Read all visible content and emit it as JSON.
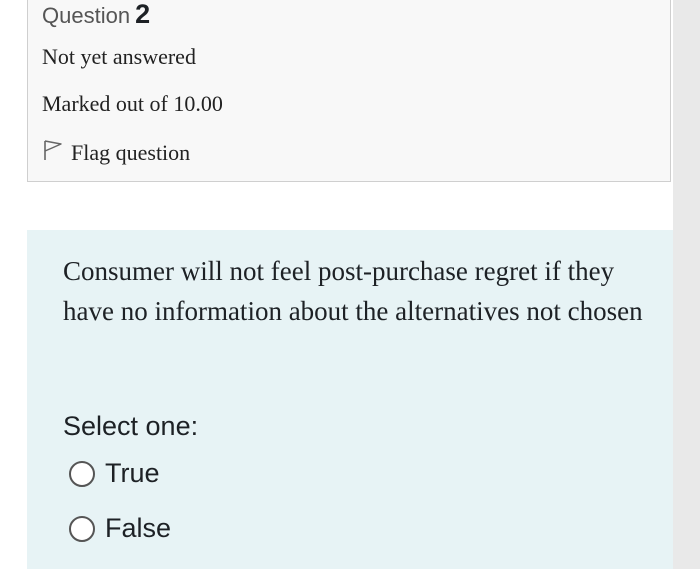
{
  "question": {
    "label": "Question",
    "number": "2",
    "state": "Not yet answered",
    "grade": "Marked out of 10.00",
    "flag_label": "Flag question",
    "text": "Consumer will not feel post-purchase regret if they have no information about the alternatives not chosen",
    "prompt": "Select one:",
    "options": [
      {
        "label": "True",
        "selected": false
      },
      {
        "label": "False",
        "selected": false
      }
    ]
  },
  "colors": {
    "info_background": "#f8f8f8",
    "formulation_background": "#e7f3f5"
  },
  "icons": {
    "flag": "flag-icon"
  }
}
